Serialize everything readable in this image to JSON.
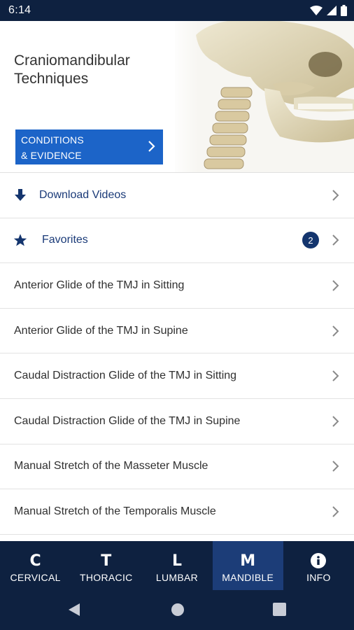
{
  "status_bar": {
    "time": "6:14",
    "icons": [
      "wifi-icon",
      "signal-icon",
      "battery-icon"
    ]
  },
  "header": {
    "title": "Craniomandibular Techniques",
    "conditions_button": {
      "line1": "CONDITIONS",
      "line2": "& EVIDENCE"
    },
    "image": "skull-illustration"
  },
  "list": {
    "download_label": "Download Videos",
    "favorites_label": "Favorites",
    "favorites_count": "2",
    "items": [
      "Anterior Glide of the TMJ in Sitting",
      "Anterior Glide of the TMJ in Supine",
      "Caudal Distraction Glide of the TMJ in Sitting",
      "Caudal Distraction Glide of the TMJ in Supine",
      "Manual Stretch of the Masseter Muscle",
      "Manual Stretch of the Temporalis Muscle"
    ]
  },
  "bottom_nav": {
    "items": [
      {
        "letter": "C",
        "label": "CERVICAL"
      },
      {
        "letter": "T",
        "label": "THORACIC"
      },
      {
        "letter": "L",
        "label": "LUMBAR"
      },
      {
        "letter": "M",
        "label": "MANDIBLE"
      },
      {
        "letter": "",
        "label": "INFO",
        "icon": "info-icon"
      }
    ],
    "active": "MANDIBLE"
  },
  "colors": {
    "nav_background": "#0e2140",
    "nav_active": "#1c3d78",
    "button_blue": "#1c64c8",
    "link_text": "#1a3a78",
    "badge": "#14356e"
  }
}
